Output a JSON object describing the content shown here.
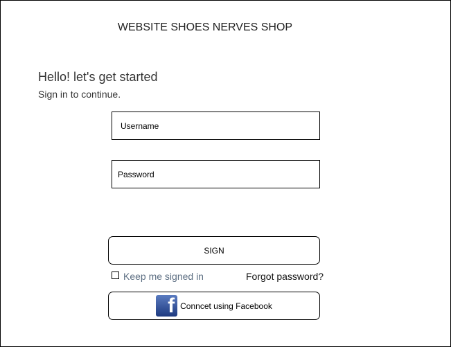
{
  "header": {
    "title": "WEBSITE SHOES NERVES SHOP"
  },
  "intro": {
    "greeting": "Hello! let's get started",
    "subtitle": "Sign in to continue."
  },
  "form": {
    "username_placeholder": "Username",
    "password_placeholder": "Password",
    "sign_label": "SIGN",
    "keep_signed_in": "Keep me signed in",
    "forgot_password": "Forgot password?",
    "facebook_label": "Conncet using Facebook",
    "facebook_icon_glyph": "f"
  }
}
